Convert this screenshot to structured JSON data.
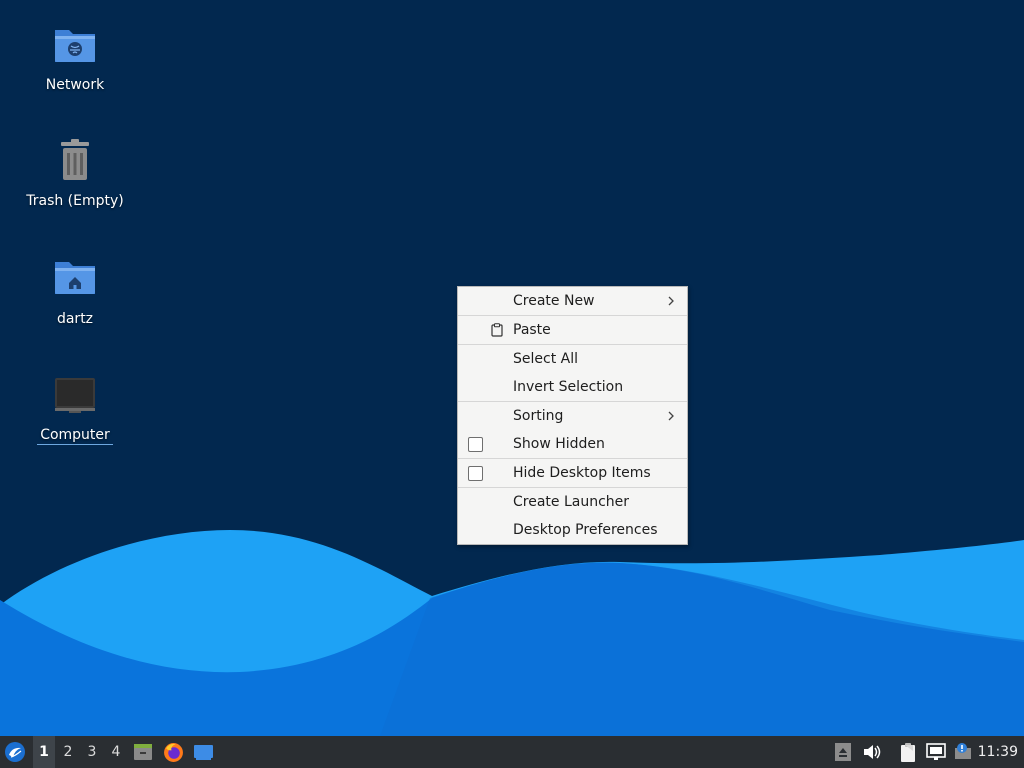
{
  "desktop": {
    "icons": [
      {
        "label": "Network",
        "icon": "network-folder-icon"
      },
      {
        "label": "Trash (Empty)",
        "icon": "trash-icon"
      },
      {
        "label": "dartz",
        "icon": "home-folder-icon"
      },
      {
        "label": "Computer",
        "icon": "computer-icon"
      }
    ]
  },
  "context_menu": {
    "items": [
      {
        "label": "Create New",
        "submenu": true
      },
      {
        "label": "Paste",
        "icon": "paste-icon"
      },
      {
        "label": "Select All"
      },
      {
        "label": "Invert Selection"
      },
      {
        "label": "Sorting",
        "submenu": true
      },
      {
        "label": "Show Hidden",
        "checked": false
      },
      {
        "label": "Hide Desktop Items",
        "checked": false
      },
      {
        "label": "Create Launcher"
      },
      {
        "label": "Desktop Preferences"
      }
    ]
  },
  "taskbar": {
    "workspaces": [
      "1",
      "2",
      "3",
      "4"
    ],
    "active_workspace": "1",
    "launchers": [
      "file-manager-icon",
      "firefox-icon",
      "show-desktop-icon"
    ],
    "tray": [
      "eject-icon",
      "volume-icon",
      "clipboard-icon",
      "network-icon",
      "update-notifier-icon"
    ],
    "clock": "11:39"
  },
  "colors": {
    "desktop_bg": "#02284f",
    "wave_light": "#1ea2f5",
    "wave_dark": "#0a74dc",
    "taskbar_bg": "#2a2e32",
    "menu_bg": "#f5f5f4"
  }
}
